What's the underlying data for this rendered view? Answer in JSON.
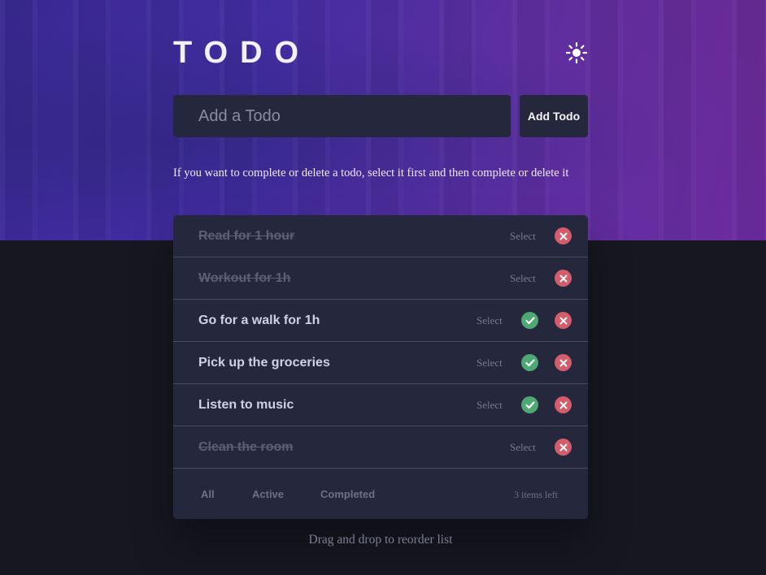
{
  "header": {
    "title": "TODO",
    "theme_icon": "sun-icon"
  },
  "add": {
    "placeholder": "Add a Todo",
    "value": "",
    "button_label": "Add Todo"
  },
  "hint": "If you want to complete or delete a todo, select it first and then complete or delete it",
  "todos": [
    {
      "text": "Read for 1 hour",
      "completed": true,
      "select_label": "Select"
    },
    {
      "text": "Workout for 1h",
      "completed": true,
      "select_label": "Select"
    },
    {
      "text": "Go for a walk for 1h",
      "completed": false,
      "select_label": "Select"
    },
    {
      "text": "Pick up the groceries",
      "completed": false,
      "select_label": "Select"
    },
    {
      "text": "Listen to music",
      "completed": false,
      "select_label": "Select"
    },
    {
      "text": "Clean the room",
      "completed": true,
      "select_label": "Select"
    }
  ],
  "footer": {
    "filters": [
      "All",
      "Active",
      "Completed"
    ],
    "items_left": "3 items left"
  },
  "drag_note": "Drag and drop to reorder list",
  "colors": {
    "check": "#4ea874",
    "delete": "#d45d6b",
    "panel": "#25273c",
    "background": "#171721"
  }
}
